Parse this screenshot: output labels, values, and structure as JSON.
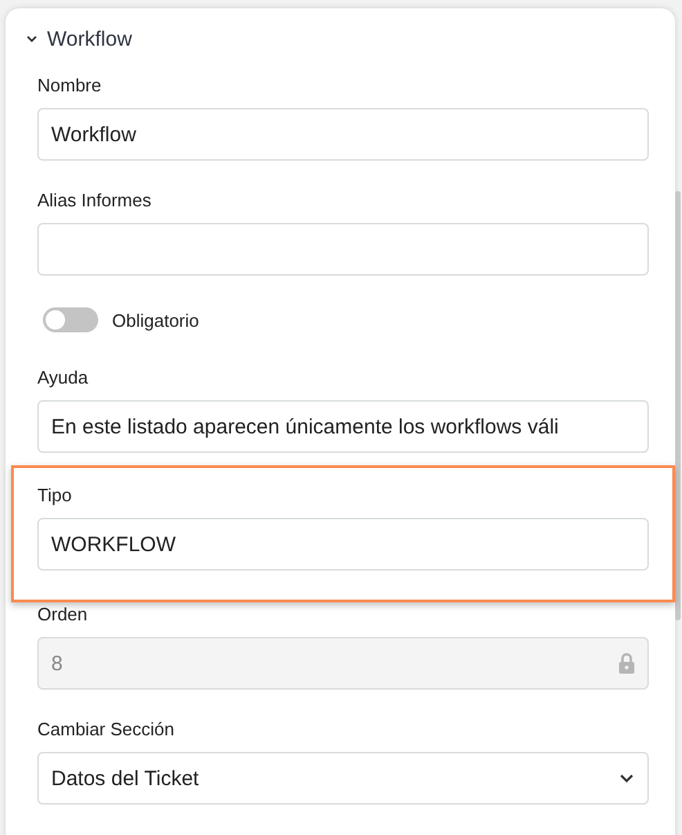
{
  "section": {
    "title": "Workflow",
    "expanded": true
  },
  "fields": [
    {
      "kind": "text",
      "label": "Nombre",
      "value": "Workflow",
      "highlighted": false
    },
    {
      "kind": "text",
      "label": "Alias Informes",
      "highlighted": false
    },
    {
      "kind": "toggle",
      "label": "Obligatorio",
      "on": false
    },
    {
      "kind": "text",
      "label": "Ayuda",
      "value": "En este listado aparecen únicamente los workflows váli",
      "highlighted": false
    },
    {
      "kind": "text",
      "label": "Tipo",
      "value": "WORKFLOW",
      "highlighted": true
    },
    {
      "kind": "locked",
      "label": "Orden",
      "value": "8",
      "highlighted": false
    },
    {
      "kind": "select",
      "label": "Cambiar Sección",
      "value": "Datos del Ticket",
      "highlighted": false
    }
  ]
}
